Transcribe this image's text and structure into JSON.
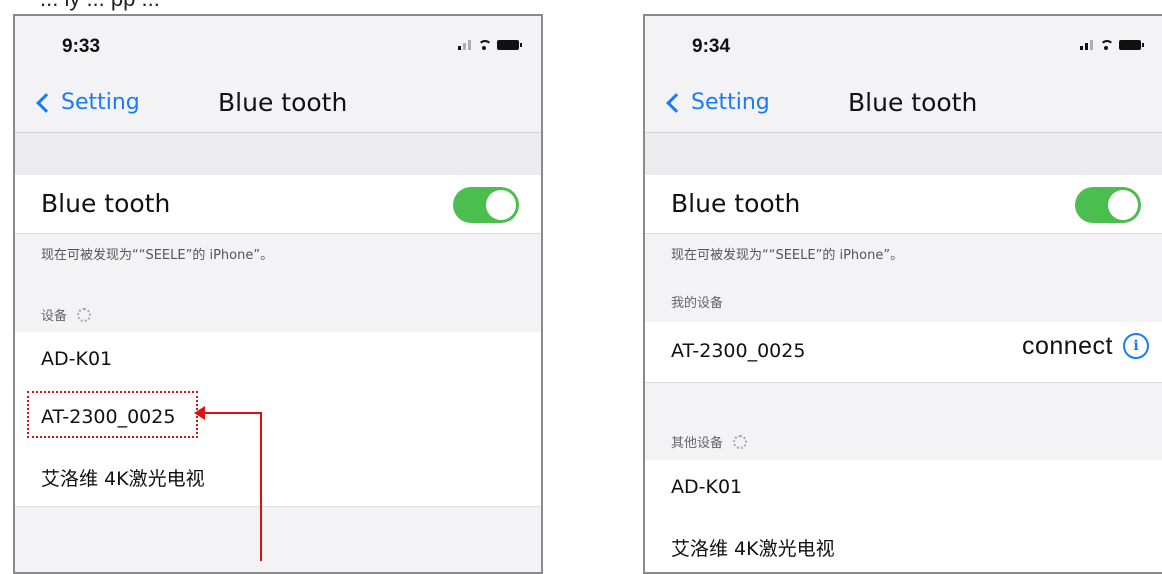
{
  "caption": "... ly ... pp ...",
  "phone1": {
    "time": "9:33",
    "back_label": "Setting",
    "title": "Blue tooth",
    "bluetooth_label": "Blue tooth",
    "bluetooth_on": true,
    "discoverable_note": "现在可被发现为““SEELE”的 iPhone”。",
    "devices_header": "设备",
    "devices": [
      "AD-K01",
      "AT-2300_0025",
      "艾洛维 4K激光电视"
    ]
  },
  "phone2": {
    "time": "9:34",
    "back_label": "Setting",
    "title": "Blue tooth",
    "bluetooth_label": "Blue tooth",
    "bluetooth_on": true,
    "discoverable_note": "现在可被发现为““SEELE”的 iPhone”。",
    "my_devices_header": "我的设备",
    "my_device": {
      "name": "AT-2300_0025",
      "status": "connect"
    },
    "other_devices_header": "其他设备",
    "other_devices": [
      "AD-K01",
      "艾洛维 4K激光电视"
    ]
  },
  "colors": {
    "accent": "#1a7cf5",
    "toggle_on": "#4cbd4f",
    "annotation": "#dd1111"
  },
  "icons": [
    "chevron-left-icon",
    "signal-icon",
    "wifi-icon",
    "battery-icon",
    "spinner-icon",
    "info-icon"
  ]
}
